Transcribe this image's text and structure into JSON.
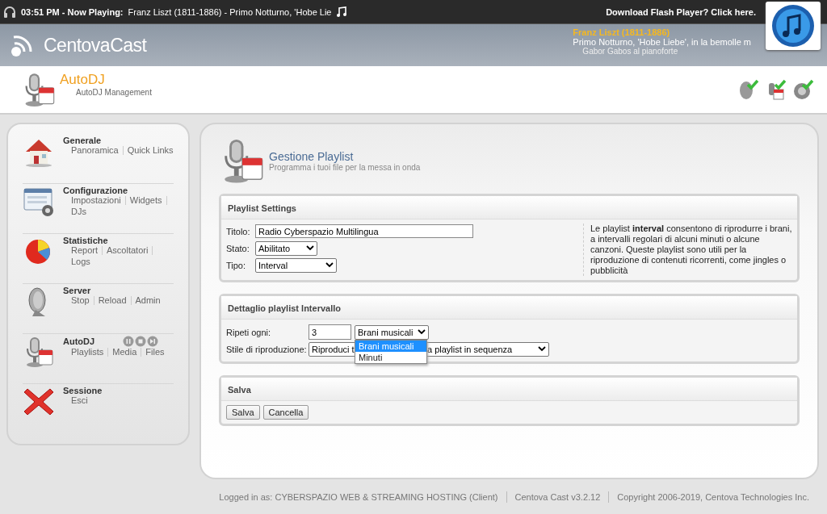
{
  "ticker": {
    "label": "03:51 PM - Now Playing:",
    "track": "Franz Liszt (1811-1886) - Primo Notturno, 'Hobe Lie",
    "notice": "Download Flash Player? Click here."
  },
  "header": {
    "logo": "CentovaCast",
    "now_playing": {
      "artist": "Franz Liszt (1811-1886)",
      "title": "Primo Notturno, 'Hobe Liebe', in la bemolle m",
      "performer": "Gabor Gabos al pianoforte"
    }
  },
  "page": {
    "title": "AutoDJ",
    "subtitle": "AutoDJ Management"
  },
  "sidebar": [
    {
      "kind": "house",
      "title": "Generale",
      "links": [
        "Panoramica",
        "Quick Links"
      ]
    },
    {
      "kind": "config",
      "title": "Configurazione",
      "links": [
        "Impostazioni",
        "Widgets",
        "DJs"
      ]
    },
    {
      "kind": "stats",
      "title": "Statistiche",
      "links": [
        "Report",
        "Ascoltatori",
        "Logs"
      ]
    },
    {
      "kind": "server",
      "title": "Server",
      "links": [
        "Stop",
        "Reload",
        "Admin"
      ]
    },
    {
      "kind": "autodj",
      "title": "AutoDJ",
      "links": [
        "Playlists",
        "Media",
        "Files"
      ]
    },
    {
      "kind": "session",
      "title": "Sessione",
      "links": [
        "Esci"
      ]
    }
  ],
  "heading": {
    "title": "Gestione Playlist",
    "subtitle": "Programma i tuoi file per la messa in onda"
  },
  "settings": {
    "title": "Playlist Settings",
    "fields": [
      {
        "kind": "text",
        "label": "Titolo:",
        "value": "Radio Cyberspazio Multilingua"
      },
      {
        "kind": "select",
        "label": "Stato:",
        "value": "Abilitato"
      },
      {
        "kind": "select",
        "label": "Tipo:",
        "value": "Interval"
      }
    ],
    "help": "Le playlist **interval** consentono di riprodurre i brani, a intervalli regolari di alcuni minuti o alcune canzoni. Queste playlist sono utili per la riproduzione di contenuti ricorrenti, come jingles o pubblicità"
  },
  "detail": {
    "title": "Dettaglio playlist Intervallo",
    "repeat": {
      "label": "Ripeti ogni:",
      "value": "3",
      "unit": "Brani musicali",
      "expanded": true,
      "options": [
        {
          "label": "Brani musicali",
          "selected": true
        },
        {
          "label": "Minuti",
          "selected": false
        }
      ]
    },
    "style": {
      "label": "Stile di riproduzione:",
      "value_start": "Riproduci t",
      "value_end": "a playlist in sequenza"
    }
  },
  "save": {
    "title": "Salva",
    "buttons": [
      "Salva",
      "Cancella"
    ]
  },
  "footer": [
    "Logged in as: CYBERSPAZIO WEB & STREAMING HOSTING (Client)",
    "Centova Cast v3.2.12",
    "Copyright 2006-2019, Centova Technologies Inc."
  ]
}
